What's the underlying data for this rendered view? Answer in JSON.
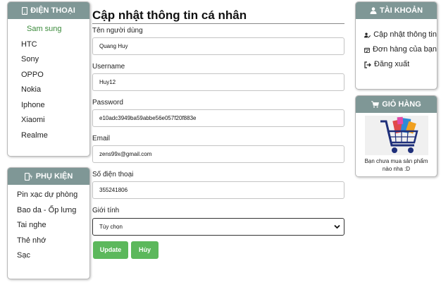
{
  "left": {
    "phones": {
      "title": "ĐIỆN THOẠI",
      "items": [
        "Sam sung",
        "HTC",
        "Sony",
        "OPPO",
        "Nokia",
        "Iphone",
        "Xiaomi",
        "Realme"
      ]
    },
    "accessories": {
      "title": "PHỤ KIỆN",
      "items": [
        "Pin xạc dự phòng",
        "Bao da - Ốp lưng",
        "Tai nghe",
        "Thẻ nhớ",
        "Sạc"
      ]
    }
  },
  "form": {
    "title": "Cập nhật thông tin cá nhân",
    "name_label": "Tên người dùng",
    "name_value": "Quang Huy",
    "username_label": "Username",
    "username_value": "Huy12",
    "password_label": "Password",
    "password_value": "e10adc3949ba59abbe56e057f20f883e",
    "email_label": "Email",
    "email_value": "zens99x@gmail.com",
    "phone_label": "Số điện thoại",
    "phone_value": "355241806",
    "gender_label": "Giới tính",
    "gender_value": "Tùy chọn",
    "update_label": "Update",
    "cancel_label": "Hủy"
  },
  "right": {
    "account": {
      "title": "TÀI KHOẢN",
      "items": [
        {
          "label": "Cập nhật thông tin",
          "icon": "user-edit-icon"
        },
        {
          "label": "Đơn hàng của bạn",
          "icon": "calendar-check-icon"
        },
        {
          "label": "Đăng xuất",
          "icon": "sign-out-icon"
        }
      ]
    },
    "cart": {
      "title": "GIỎ HÀNG",
      "empty_text": "Bạn chưa mua sản phẩm nào nha :D"
    }
  },
  "colors": {
    "panel_header": "#7f9796",
    "button": "#5cb85c",
    "active_item": "#3a8a3a"
  }
}
